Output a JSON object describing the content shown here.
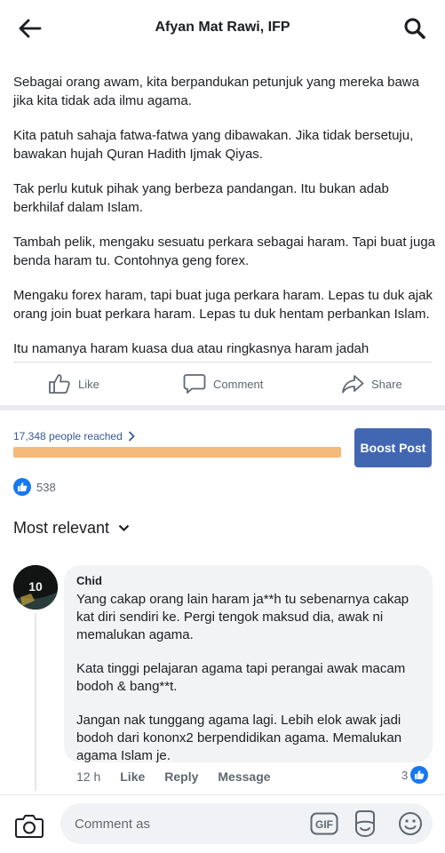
{
  "header": {
    "title": "Afyan Mat Rawi, IFP",
    "back_icon": "arrow-left-icon",
    "search_icon": "search-icon"
  },
  "post": {
    "paragraphs": [
      "Sebagai orang awam, kita berpandukan petunjuk yang mereka bawa jika kita tidak ada ilmu agama.",
      "Kita patuh sahaja fatwa-fatwa yang dibawakan. Jika tidak bersetuju, bawakan hujah Quran Hadith Ijmak Qiyas.",
      "Tak perlu kutuk pihak yang berbeza pandangan. Itu bukan adab berkhilaf dalam Islam.",
      "Tambah pelik, mengaku sesuatu perkara sebagai haram. Tapi buat juga benda haram tu. Contohnya geng forex.",
      "Mengaku forex haram, tapi buat juga perkara haram. Lepas tu duk ajak orang join buat perkara haram. Lepas tu duk hentam perbankan Islam.",
      "Itu namanya haram kuasa dua atau ringkasnya haram jadah"
    ]
  },
  "actions": {
    "like_label": "Like",
    "comment_label": "Comment",
    "share_label": "Share"
  },
  "reach": {
    "text": "17,348 people reached",
    "progress_fraction": 1.0,
    "boost_label": "Boost Post"
  },
  "reactions": {
    "count": "538"
  },
  "comments_filter": {
    "label": "Most relevant"
  },
  "comment": {
    "author": "Chid",
    "avatar_text": "10",
    "paragraphs": [
      "Yang cakap orang lain haram ja**h tu sebenarnya cakap kat diri sendiri ke. Pergi tengok maksud dia, awak ni memalukan agama.",
      "Kata tinggi pelajaran agama tapi perangai awak macam bodoh & bang**t.",
      "Jangan nak tunggang agama lagi. Lebih elok awak jadi bodoh dari kononx2 berpendidikan agama. Memalukan agama Islam je."
    ],
    "time": "12 h",
    "like_label": "Like",
    "reply_label": "Reply",
    "message_label": "Message",
    "reaction_count": "3"
  },
  "composer": {
    "placeholder": "Comment as",
    "gif_label": "GIF"
  },
  "colors": {
    "accent": "#4267b2",
    "link": "#385898",
    "reach_bar": "#f7c28a",
    "like_blue": "#1877f2"
  }
}
